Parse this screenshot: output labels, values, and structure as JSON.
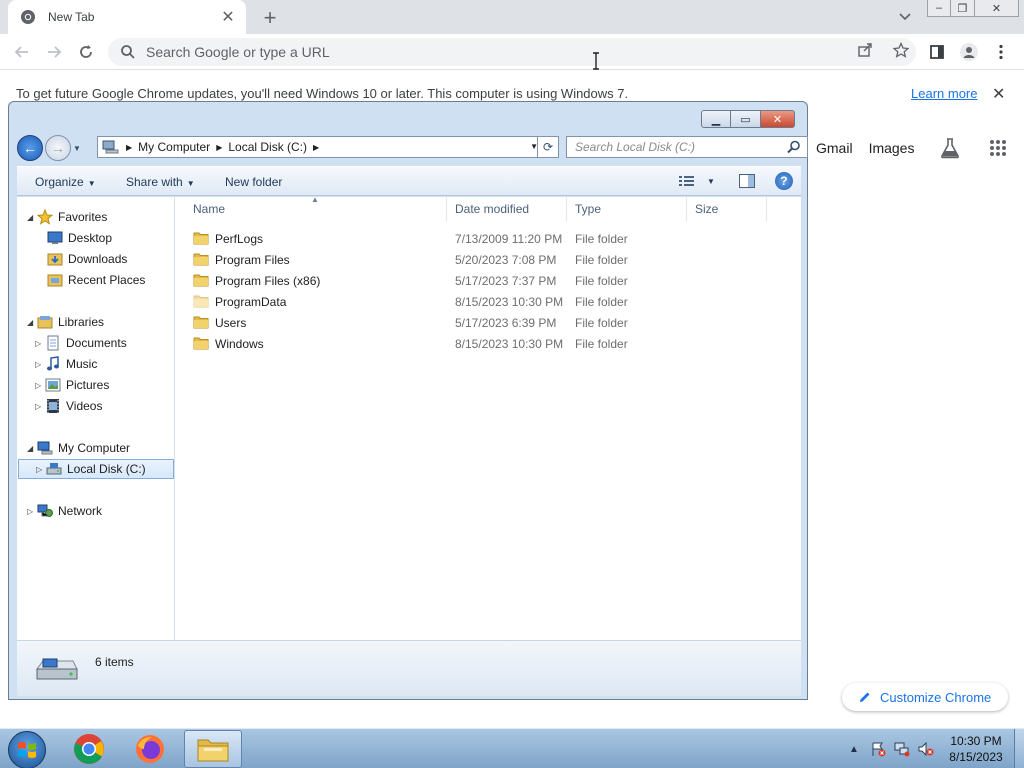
{
  "browser": {
    "tab_title": "New Tab",
    "omnibox_placeholder": "Search Google or type a URL",
    "infobar_message": "To get future Google Chrome updates, you'll need Windows 10 or later. This computer is using Windows 7.",
    "infobar_link": "Learn more",
    "ntp_links": [
      "Gmail",
      "Images"
    ],
    "customize_label": "Customize Chrome",
    "accent": "#1a73e8"
  },
  "explorer": {
    "breadcrumb": [
      "My Computer",
      "Local Disk (C:)"
    ],
    "search_placeholder": "Search Local Disk (C:)",
    "commands": [
      "Organize",
      "Share with",
      "New folder"
    ],
    "nav": {
      "favorites": "Favorites",
      "desktop": "Desktop",
      "downloads": "Downloads",
      "recent": "Recent Places",
      "libraries": "Libraries",
      "documents": "Documents",
      "music": "Music",
      "pictures": "Pictures",
      "videos": "Videos",
      "computer": "My Computer",
      "local_disk": "Local Disk (C:)",
      "network": "Network"
    },
    "columns": [
      "Name",
      "Date modified",
      "Type",
      "Size"
    ],
    "files": [
      {
        "name": "PerfLogs",
        "date": "7/13/2009 11:20 PM",
        "type": "File folder",
        "size": ""
      },
      {
        "name": "Program Files",
        "date": "5/20/2023 7:08 PM",
        "type": "File folder",
        "size": ""
      },
      {
        "name": "Program Files (x86)",
        "date": "5/17/2023 7:37 PM",
        "type": "File folder",
        "size": ""
      },
      {
        "name": "ProgramData",
        "date": "8/15/2023 10:30 PM",
        "type": "File folder",
        "size": ""
      },
      {
        "name": "Users",
        "date": "5/17/2023 6:39 PM",
        "type": "File folder",
        "size": ""
      },
      {
        "name": "Windows",
        "date": "8/15/2023 10:30 PM",
        "type": "File folder",
        "size": ""
      }
    ],
    "item_count": "6 items"
  },
  "taskbar": {
    "apps": [
      "chrome-icon",
      "firefox-icon",
      "explorer-icon"
    ],
    "time": "10:30 PM",
    "date": "8/15/2023"
  }
}
